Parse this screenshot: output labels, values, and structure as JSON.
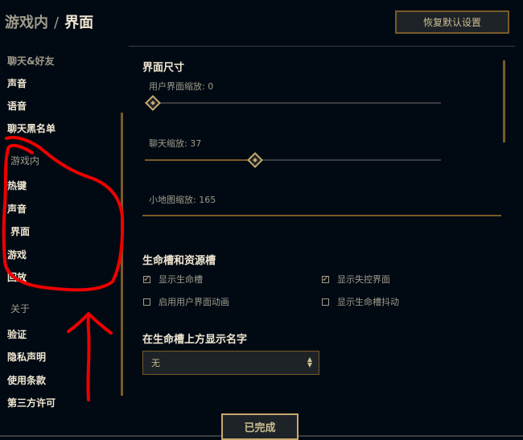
{
  "breadcrumb": {
    "parent": "游戏内",
    "separator": "/",
    "current": "界面"
  },
  "reset_button": "恢复默认设置",
  "sidebar": {
    "items": [
      {
        "label": "聊天&好友",
        "style": "dim"
      },
      {
        "label": "声音",
        "style": "bold"
      },
      {
        "label": "语音",
        "style": "bold"
      },
      {
        "label": "聊天黑名单",
        "style": "bold"
      },
      {
        "label": "游戏内",
        "style": "header"
      },
      {
        "label": "热键",
        "style": "bold"
      },
      {
        "label": "声音",
        "style": "bold"
      },
      {
        "label": "界面",
        "style": "active"
      },
      {
        "label": "游戏",
        "style": "bold"
      },
      {
        "label": "回放",
        "style": "bold"
      },
      {
        "label": "关于",
        "style": "header"
      },
      {
        "label": "验证",
        "style": "bold"
      },
      {
        "label": "隐私声明",
        "style": "bold"
      },
      {
        "label": "使用条款",
        "style": "bold"
      },
      {
        "label": "第三方许可",
        "style": "bold"
      }
    ]
  },
  "interface_size": {
    "title": "界面尺寸",
    "ui_scale": {
      "label": "用户界面缩放: 0",
      "value": 0
    },
    "chat_scale": {
      "label": "聊天缩放: 37",
      "value": 37
    },
    "minimap_scale": {
      "label": "小地图缩放: 165"
    }
  },
  "health_bars": {
    "title": "生命槽和资源槽",
    "options": [
      {
        "label": "显示生命槽",
        "checked": true
      },
      {
        "label": "显示失控界面",
        "checked": true
      },
      {
        "label": "启用用户界面动画",
        "checked": false
      },
      {
        "label": "显示生命槽抖动",
        "checked": false
      }
    ]
  },
  "name_display": {
    "title": "在生命槽上方显示名字",
    "selected": "无"
  },
  "done_button": "已完成",
  "colors": {
    "gold": "#c8aa6e",
    "background": "#010a13",
    "annotation": "#ee0000"
  }
}
